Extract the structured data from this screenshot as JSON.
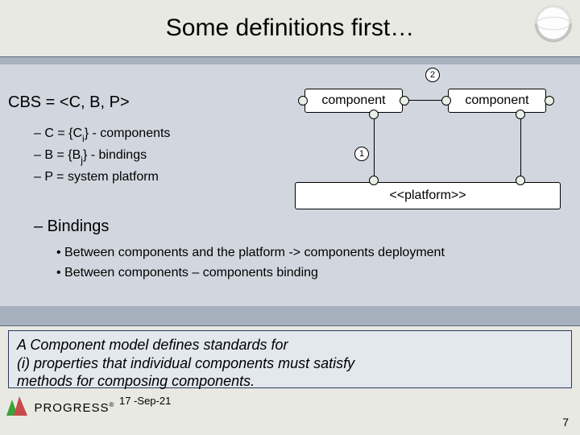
{
  "title": "Some definitions first…",
  "def": {
    "line": "CBS = <C, B, P>"
  },
  "bullets": {
    "c_pre": "–  C = {C",
    "c_sub": "i",
    "c_post": "} - components",
    "b_pre": "–  B = {B",
    "b_sub": "j",
    "b_post": "} - bindings",
    "p": "–  P = system platform"
  },
  "bindings": {
    "head": "–  Bindings",
    "line1": "•  Between components and the platform -> components deployment",
    "line2": "•  Between components – components binding"
  },
  "summary": {
    "l1": "A Component model defines standards for",
    "l2": "(i) properties that individual components must satisfy",
    "l3": "methods for composing components."
  },
  "diagram": {
    "compA": "component",
    "compB": "component",
    "platform": "<<platform>>",
    "label1": "1",
    "label2": "2"
  },
  "footer": {
    "date": "17 -Sep-21",
    "slide_num": "7",
    "brand": "PROGRESS",
    "brand_r": "®"
  }
}
